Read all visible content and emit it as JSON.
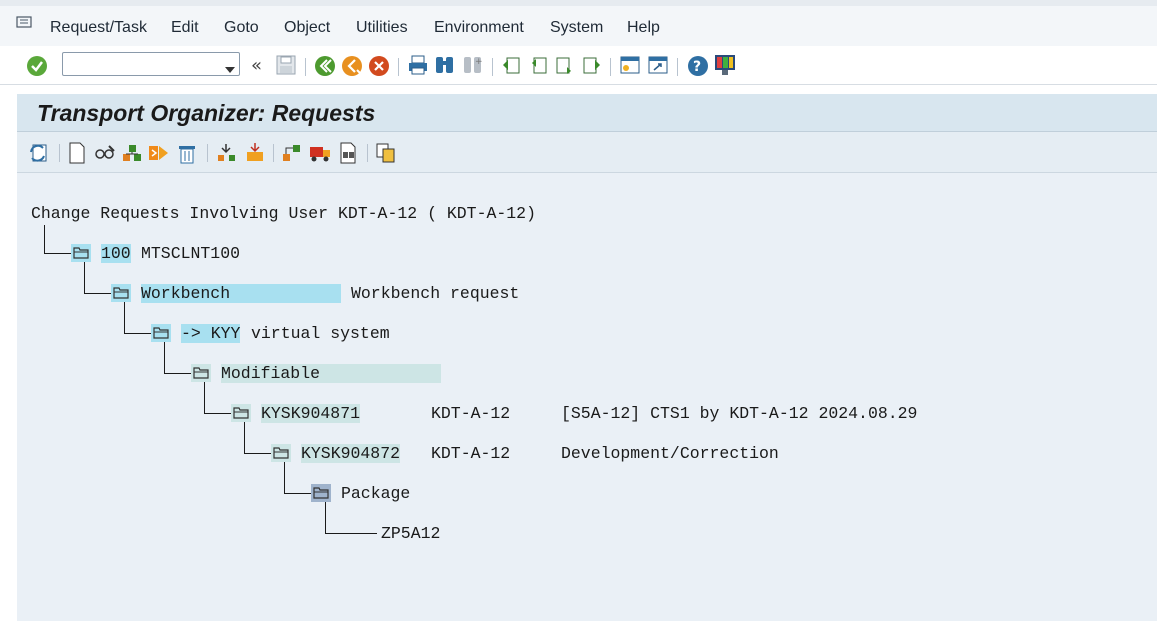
{
  "menu": {
    "items": [
      "Request/Task",
      "Edit",
      "Goto",
      "Object",
      "Utilities",
      "Environment",
      "System",
      "Help"
    ]
  },
  "command_field": {
    "value": ""
  },
  "title": "Transport Organizer: Requests",
  "tree": {
    "root": "Change Requests Involving User KDT-A-12 ( KDT-A-12)",
    "client_id": "100",
    "client_name": "MTSCLNT100",
    "workbench_label": "Workbench",
    "workbench_desc": "Workbench request",
    "target_label": "-> KYY",
    "target_desc": "virtual system",
    "status_label": "Modifiable",
    "request_id": "KYSK904871",
    "request_owner": "KDT-A-12",
    "request_desc": "[S5A-12] CTS1 by KDT-A-12 2024.08.29",
    "task_id": "KYSK904872",
    "task_owner": "KDT-A-12",
    "task_desc": "Development/Correction",
    "package_label": "Package",
    "package_name": "ZP5A12"
  },
  "colors": {
    "title_bar": "#d8e6ef",
    "content_bg": "#eaf0f6",
    "highlight": "#a8e0f0",
    "highlight_soft": "#cde5e5"
  }
}
